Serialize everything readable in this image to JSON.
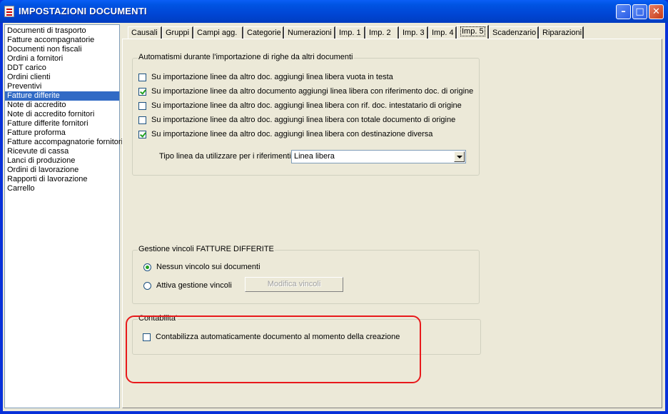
{
  "window": {
    "title": "IMPOSTAZIONI DOCUMENTI",
    "minimize_glyph": "–",
    "maximize_glyph": "□",
    "close_glyph": "✕"
  },
  "sidebar": {
    "items": [
      "Documenti di trasporto",
      "Fatture accompagnatorie",
      "Documenti non fiscali",
      "Ordini a fornitori",
      "DDT carico",
      "Ordini clienti",
      "Preventivi",
      "Fatture differite",
      "Note di accredito",
      "Note di accredito fornitori",
      "Fatture differite fornitori",
      "Fatture proforma",
      "Fatture accompagnatorie fornitori",
      "Ricevute di cassa",
      "Lanci di produzione",
      "Ordini di lavorazione",
      "Rapporti di lavorazione",
      "Carrello"
    ],
    "selected": "Fatture differite"
  },
  "tabs": [
    "Causali",
    "Gruppi",
    "Campi agg.",
    "Categorie",
    "Numerazioni",
    "Imp. 1",
    "Imp. 2",
    "Imp. 3",
    "Imp. 4",
    "Imp. 5",
    "Scadenzario",
    "Riparazioni"
  ],
  "active_tab": "Imp. 5",
  "import_group": {
    "legend": "Automatismi durante l'importazione di righe da altri documenti",
    "options": [
      {
        "label": "Su importazione linee da altro doc. aggiungi linea libera vuota in testa",
        "checked": false
      },
      {
        "label": "Su importazione linee da altro documento aggiungi linea libera con riferimento doc. di origine",
        "checked": true
      },
      {
        "label": "Su importazione linee da altro doc. aggiungi linea libera con rif. doc. intestatario di origine",
        "checked": false
      },
      {
        "label": "Su importazione linee da altro doc. aggiungi linea libera con totale documento di origine",
        "checked": false
      },
      {
        "label": "Su importazione linee da altro doc. aggiungi linea libera con destinazione diversa",
        "checked": true
      }
    ],
    "line_type_label": "Tipo linea da utilizzare per i riferimenti :",
    "line_type_value": "Linea libera"
  },
  "constraints_group": {
    "legend": "Gestione vincoli FATTURE DIFFERITE",
    "radio_none": "Nessun vincolo sui documenti",
    "radio_active": "Attiva gestione vincoli",
    "selected": "none",
    "edit_button": "Modifica vincoli"
  },
  "accounting_group": {
    "legend": "Contabilita'",
    "checkbox_label": "Contabilizza automaticamente documento al momento della creazione",
    "checked": false
  },
  "colors": {
    "titlebar": "#0054e3",
    "selection": "#316ac5",
    "highlight_annotation": "#e8191b",
    "face": "#ece9d8"
  }
}
